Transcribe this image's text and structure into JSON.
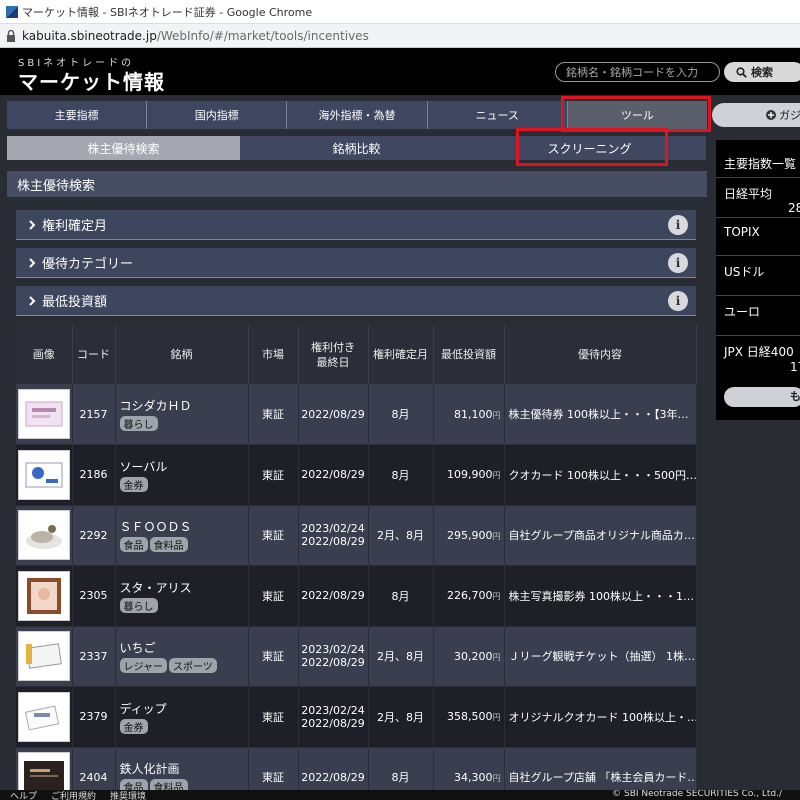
{
  "window": {
    "title": "マーケット情報 - SBIネオトレード証券 - Google Chrome",
    "url_host": "kabuita.sbineotrade.jp",
    "url_path": "/WebInfo/#/market/tools/incentives"
  },
  "header": {
    "logo_sub": "SBIネオトレードの",
    "logo_main": "マーケット情報",
    "search_placeholder": "銘柄名・銘柄コードを入力",
    "search_button": "検索"
  },
  "nav": {
    "items": [
      "主要指標",
      "国内指標",
      "海外指標・為替",
      "ニュース",
      "ツール"
    ],
    "active_index": 4,
    "gadget_label": "ガジ"
  },
  "sub_tabs": {
    "items": [
      "株主優待検索",
      "銘柄比較",
      "スクリーニング"
    ],
    "active_index": 0
  },
  "panel": {
    "title": "株主優待検索",
    "filters": [
      "権利確定月",
      "優待カテゴリー",
      "最低投資額"
    ],
    "info_label": "i"
  },
  "table": {
    "headers": {
      "image": "画像",
      "code": "コード",
      "name": "銘柄",
      "market": "市場",
      "last_date_1": "権利付き",
      "last_date_2": "最終日",
      "month": "権利確定月",
      "min_investment": "最低投資額",
      "benefit": "優待内容"
    },
    "yen_unit": "円",
    "rows": [
      {
        "code": "2157",
        "name": "コシダカＨＤ",
        "tags": [
          "暮らし"
        ],
        "market": "東証",
        "date1": "2022/08/29",
        "date2": "",
        "month": "8月",
        "price": "81,100",
        "benefit": "株主優待券 100株以上・・・【3年…"
      },
      {
        "code": "2186",
        "name": "ソーバル",
        "tags": [
          "金券"
        ],
        "market": "東証",
        "date1": "2022/08/29",
        "date2": "",
        "month": "8月",
        "price": "109,900",
        "benefit": "クオカード 100株以上・・・500円…"
      },
      {
        "code": "2292",
        "name": "ＳＦＯＯＤＳ",
        "tags": [
          "食品",
          "食料品"
        ],
        "market": "東証",
        "date1": "2023/02/24",
        "date2": "2022/08/29",
        "month": "2月、8月",
        "price": "295,900",
        "benefit": "自社グループ商品オリジナル商品カ…"
      },
      {
        "code": "2305",
        "name": "スタ・アリス",
        "tags": [
          "暮らし"
        ],
        "market": "東証",
        "date1": "2022/08/29",
        "date2": "",
        "month": "8月",
        "price": "226,700",
        "benefit": "株主写真撮影券 100株以上・・・1…"
      },
      {
        "code": "2337",
        "name": "いちご",
        "tags": [
          "レジャー",
          "スポーツ"
        ],
        "market": "東証",
        "date1": "2023/02/24",
        "date2": "2022/08/29",
        "month": "2月、8月",
        "price": "30,200",
        "benefit": "Ｊリーグ観戦チケット（抽選） 1株…"
      },
      {
        "code": "2379",
        "name": "ディップ",
        "tags": [
          "金券"
        ],
        "market": "東証",
        "date1": "2023/02/24",
        "date2": "2022/08/29",
        "month": "2月、8月",
        "price": "358,500",
        "benefit": "オリジナルクオカード 100株以上・…"
      },
      {
        "code": "2404",
        "name": "鉄人化計画",
        "tags": [
          "食品",
          "食料品"
        ],
        "market": "東証",
        "date1": "2022/08/29",
        "date2": "",
        "month": "8月",
        "price": "34,300",
        "benefit": "自社グループ店舗 「株主会員カード…"
      }
    ]
  },
  "sidebar": {
    "title": "主要指数一覧",
    "items": [
      {
        "label": "日経平均",
        "value": "28"
      },
      {
        "label": "TOPIX",
        "value": ""
      },
      {
        "label": "USドル",
        "value": ""
      },
      {
        "label": "ユーロ",
        "value": ""
      },
      {
        "label": "JPX 日経400",
        "value": "17"
      }
    ],
    "more_label": "も"
  },
  "footer": {
    "help": "ヘルプ",
    "terms": "ご利用規約",
    "env": "推奨環境",
    "copyright": "© SBI Neotrade SECURITIES Co., Ltd./"
  },
  "colors": {
    "highlight": "#e0141f",
    "nav": "#3e4660",
    "row_odd": "#3a3e4f",
    "row_even": "#1f2027"
  }
}
